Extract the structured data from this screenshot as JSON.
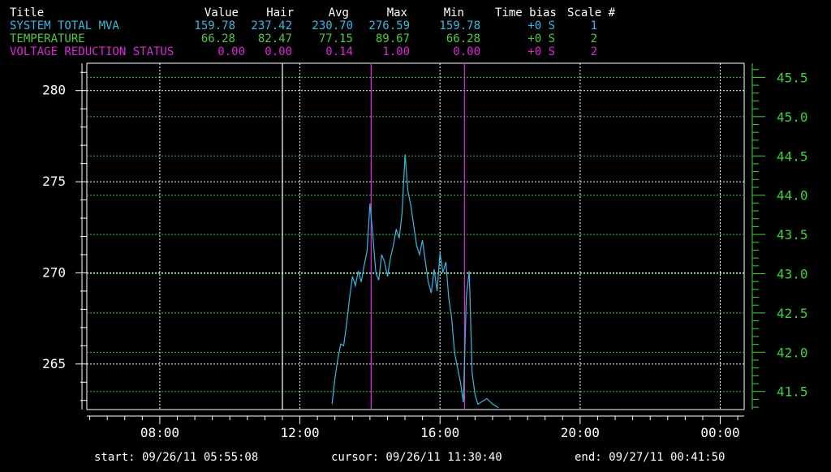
{
  "colors": {
    "header": "#ffffff",
    "mva": "#39b8e0",
    "temp": "#4fc93f",
    "vrs": "#d62ad6",
    "grid_white": "#ffffff",
    "grid_green": "#3fb83f",
    "plot_line": "#39b8e0",
    "axis_left": "#ffffff",
    "axis_right": "#3fd23f"
  },
  "table": {
    "headers": {
      "title": "Title",
      "value": "Value",
      "hair": "Hair",
      "avg": "Avg",
      "max": "Max",
      "min": "Min",
      "time_bias": "Time bias",
      "scale": "Scale #"
    },
    "rows": [
      {
        "title": "SYSTEM TOTAL MVA",
        "value": "159.78",
        "hair": "237.42",
        "avg": "230.70",
        "max": "276.59",
        "min": "159.78",
        "time_bias": "+0 S",
        "scale": "1"
      },
      {
        "title": "TEMPERATURE",
        "value": "66.28",
        "hair": "82.47",
        "avg": "77.15",
        "max": "89.67",
        "min": "66.28",
        "time_bias": "+0 S",
        "scale": "2"
      },
      {
        "title": "VOLTAGE REDUCTION STATUS",
        "value": "0.00",
        "hair": "0.00",
        "avg": "0.14",
        "max": "1.00",
        "min": "0.00",
        "time_bias": "+0 S",
        "scale": "2"
      }
    ]
  },
  "footer": {
    "start": "start: 09/26/11 05:55:08",
    "cursor": "cursor: 09/26/11 11:30:40",
    "end": "end: 09/27/11 00:41:50"
  },
  "chart_data": {
    "type": "line",
    "xlim": [
      "05:55",
      "00:41"
    ],
    "xticks": [
      "08:00",
      "12:00",
      "16:00",
      "20:00",
      "00:00"
    ],
    "left_axis": {
      "ylim": [
        262.5,
        281.5
      ],
      "ticks": [
        "265",
        "270",
        "275",
        "280"
      ],
      "tick_values": [
        265,
        270,
        275,
        280
      ]
    },
    "right_axis": {
      "ylim": [
        41.27,
        45.68
      ],
      "ticks": [
        "41.5",
        "42.0",
        "42.5",
        "43.0",
        "43.5",
        "44.0",
        "44.5",
        "45.0",
        "45.5"
      ],
      "tick_values": [
        41.5,
        42.0,
        42.5,
        43.0,
        43.5,
        44.0,
        44.5,
        45.0,
        45.5
      ]
    },
    "cursor_time": "11:30",
    "vrs_markers": [
      "14:02",
      "16:42"
    ],
    "series": [
      {
        "name": "SYSTEM TOTAL MVA",
        "axis": "left",
        "x": [
          "12:55",
          "13:00",
          "13:05",
          "13:10",
          "13:15",
          "13:20",
          "13:25",
          "13:30",
          "13:35",
          "13:40",
          "13:45",
          "13:50",
          "13:55",
          "14:00",
          "14:05",
          "14:10",
          "14:15",
          "14:20",
          "14:25",
          "14:30",
          "14:35",
          "14:40",
          "14:45",
          "14:50",
          "14:55",
          "15:00",
          "15:05",
          "15:10",
          "15:15",
          "15:20",
          "15:25",
          "15:30",
          "15:35",
          "15:40",
          "15:45",
          "15:50",
          "15:55",
          "16:00",
          "16:05",
          "16:10",
          "16:15",
          "16:20",
          "16:25",
          "16:30",
          "16:35",
          "16:40",
          "16:45",
          "16:50",
          "16:55",
          "17:00",
          "17:05",
          "17:10",
          "17:20",
          "17:30",
          "17:40"
        ],
        "y": [
          262.8,
          264.2,
          265.3,
          266.1,
          266.0,
          267.2,
          268.6,
          269.8,
          269.3,
          270.1,
          269.5,
          270.4,
          271.2,
          273.8,
          272.0,
          270.0,
          269.6,
          271.0,
          270.6,
          269.8,
          270.8,
          271.5,
          272.4,
          271.9,
          273.3,
          276.5,
          274.5,
          273.7,
          272.6,
          271.5,
          271.0,
          271.8,
          270.6,
          269.5,
          268.9,
          270.2,
          269.0,
          271.1,
          270.0,
          270.6,
          268.6,
          267.5,
          265.6,
          264.8,
          264.0,
          262.9,
          268.7,
          270.1,
          264.5,
          263.3,
          262.8,
          262.9,
          263.1,
          262.8,
          262.6
        ]
      }
    ]
  }
}
